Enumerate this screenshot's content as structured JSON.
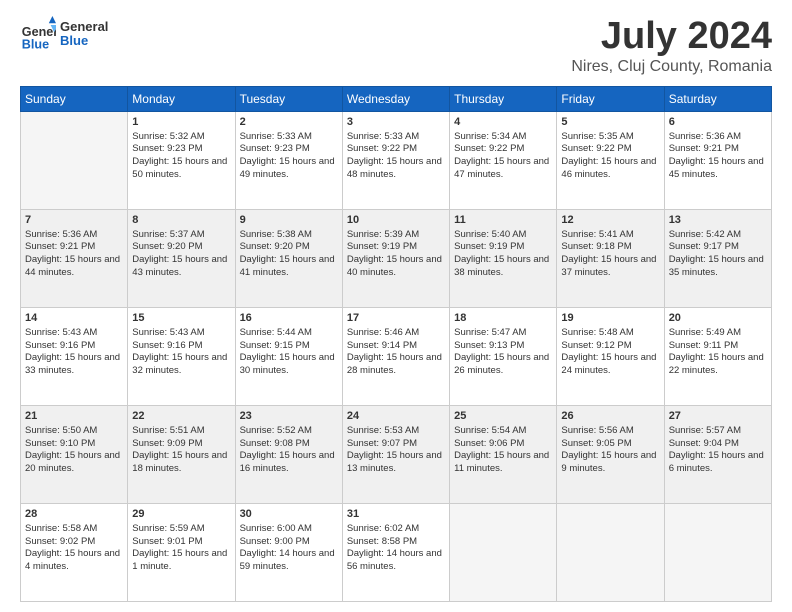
{
  "header": {
    "logo_general": "General",
    "logo_blue": "Blue",
    "month": "July 2024",
    "location": "Nires, Cluj County, Romania"
  },
  "weekdays": [
    "Sunday",
    "Monday",
    "Tuesday",
    "Wednesday",
    "Thursday",
    "Friday",
    "Saturday"
  ],
  "weeks": [
    [
      {
        "day": "",
        "empty": true
      },
      {
        "day": "1",
        "sunrise": "5:32 AM",
        "sunset": "9:23 PM",
        "daylight": "15 hours and 50 minutes."
      },
      {
        "day": "2",
        "sunrise": "5:33 AM",
        "sunset": "9:23 PM",
        "daylight": "15 hours and 49 minutes."
      },
      {
        "day": "3",
        "sunrise": "5:33 AM",
        "sunset": "9:22 PM",
        "daylight": "15 hours and 48 minutes."
      },
      {
        "day": "4",
        "sunrise": "5:34 AM",
        "sunset": "9:22 PM",
        "daylight": "15 hours and 47 minutes."
      },
      {
        "day": "5",
        "sunrise": "5:35 AM",
        "sunset": "9:22 PM",
        "daylight": "15 hours and 46 minutes."
      },
      {
        "day": "6",
        "sunrise": "5:36 AM",
        "sunset": "9:21 PM",
        "daylight": "15 hours and 45 minutes."
      }
    ],
    [
      {
        "day": "7",
        "sunrise": "5:36 AM",
        "sunset": "9:21 PM",
        "daylight": "15 hours and 44 minutes."
      },
      {
        "day": "8",
        "sunrise": "5:37 AM",
        "sunset": "9:20 PM",
        "daylight": "15 hours and 43 minutes."
      },
      {
        "day": "9",
        "sunrise": "5:38 AM",
        "sunset": "9:20 PM",
        "daylight": "15 hours and 41 minutes."
      },
      {
        "day": "10",
        "sunrise": "5:39 AM",
        "sunset": "9:19 PM",
        "daylight": "15 hours and 40 minutes."
      },
      {
        "day": "11",
        "sunrise": "5:40 AM",
        "sunset": "9:19 PM",
        "daylight": "15 hours and 38 minutes."
      },
      {
        "day": "12",
        "sunrise": "5:41 AM",
        "sunset": "9:18 PM",
        "daylight": "15 hours and 37 minutes."
      },
      {
        "day": "13",
        "sunrise": "5:42 AM",
        "sunset": "9:17 PM",
        "daylight": "15 hours and 35 minutes."
      }
    ],
    [
      {
        "day": "14",
        "sunrise": "5:43 AM",
        "sunset": "9:16 PM",
        "daylight": "15 hours and 33 minutes."
      },
      {
        "day": "15",
        "sunrise": "5:43 AM",
        "sunset": "9:16 PM",
        "daylight": "15 hours and 32 minutes."
      },
      {
        "day": "16",
        "sunrise": "5:44 AM",
        "sunset": "9:15 PM",
        "daylight": "15 hours and 30 minutes."
      },
      {
        "day": "17",
        "sunrise": "5:46 AM",
        "sunset": "9:14 PM",
        "daylight": "15 hours and 28 minutes."
      },
      {
        "day": "18",
        "sunrise": "5:47 AM",
        "sunset": "9:13 PM",
        "daylight": "15 hours and 26 minutes."
      },
      {
        "day": "19",
        "sunrise": "5:48 AM",
        "sunset": "9:12 PM",
        "daylight": "15 hours and 24 minutes."
      },
      {
        "day": "20",
        "sunrise": "5:49 AM",
        "sunset": "9:11 PM",
        "daylight": "15 hours and 22 minutes."
      }
    ],
    [
      {
        "day": "21",
        "sunrise": "5:50 AM",
        "sunset": "9:10 PM",
        "daylight": "15 hours and 20 minutes."
      },
      {
        "day": "22",
        "sunrise": "5:51 AM",
        "sunset": "9:09 PM",
        "daylight": "15 hours and 18 minutes."
      },
      {
        "day": "23",
        "sunrise": "5:52 AM",
        "sunset": "9:08 PM",
        "daylight": "15 hours and 16 minutes."
      },
      {
        "day": "24",
        "sunrise": "5:53 AM",
        "sunset": "9:07 PM",
        "daylight": "15 hours and 13 minutes."
      },
      {
        "day": "25",
        "sunrise": "5:54 AM",
        "sunset": "9:06 PM",
        "daylight": "15 hours and 11 minutes."
      },
      {
        "day": "26",
        "sunrise": "5:56 AM",
        "sunset": "9:05 PM",
        "daylight": "15 hours and 9 minutes."
      },
      {
        "day": "27",
        "sunrise": "5:57 AM",
        "sunset": "9:04 PM",
        "daylight": "15 hours and 6 minutes."
      }
    ],
    [
      {
        "day": "28",
        "sunrise": "5:58 AM",
        "sunset": "9:02 PM",
        "daylight": "15 hours and 4 minutes."
      },
      {
        "day": "29",
        "sunrise": "5:59 AM",
        "sunset": "9:01 PM",
        "daylight": "15 hours and 1 minute."
      },
      {
        "day": "30",
        "sunrise": "6:00 AM",
        "sunset": "9:00 PM",
        "daylight": "14 hours and 59 minutes."
      },
      {
        "day": "31",
        "sunrise": "6:02 AM",
        "sunset": "8:58 PM",
        "daylight": "14 hours and 56 minutes."
      },
      {
        "day": "",
        "empty": true
      },
      {
        "day": "",
        "empty": true
      },
      {
        "day": "",
        "empty": true
      }
    ]
  ]
}
